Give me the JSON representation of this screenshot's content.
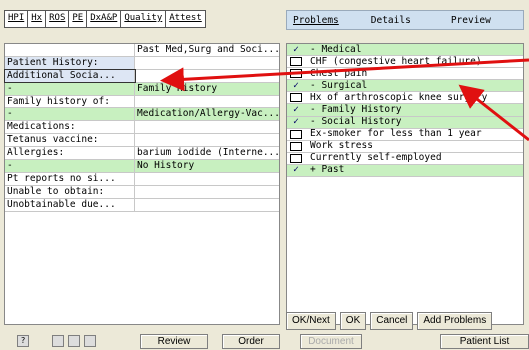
{
  "left_tabs": [
    "HPI",
    "Hx",
    "ROS",
    "PE",
    "DxA&P",
    "Quality",
    "Attest"
  ],
  "left_rows": [
    {
      "label": "",
      "value": "Past Med,Surg and Soci...",
      "kind": "header"
    },
    {
      "label": "Patient History:",
      "value": "",
      "kind": "blue"
    },
    {
      "label": "Additional Socia...",
      "value": "",
      "kind": "sel"
    },
    {
      "label": "-",
      "value": "Family History",
      "kind": "green"
    },
    {
      "label": "Family history of:",
      "value": "",
      "kind": "plain"
    },
    {
      "label": "-",
      "value": "Medication/Allergy-Vac...",
      "kind": "green"
    },
    {
      "label": "Medications:",
      "value": "",
      "kind": "plain"
    },
    {
      "label": "Tetanus vaccine:",
      "value": "",
      "kind": "plain"
    },
    {
      "label": "Allergies:",
      "value": "barium iodide (Interne...",
      "kind": "plain"
    },
    {
      "label": "-",
      "value": "No History",
      "kind": "green"
    },
    {
      "label": "Pt reports no si...",
      "value": "",
      "kind": "plain"
    },
    {
      "label": "Unable to obtain:",
      "value": "",
      "kind": "plain"
    },
    {
      "label": "Unobtainable due...",
      "value": "",
      "kind": "plain"
    }
  ],
  "right_tabs": [
    "Problems",
    "Details",
    "Preview"
  ],
  "right_rows": [
    {
      "mark": "check",
      "text": "- Medical",
      "group": true
    },
    {
      "mark": "box",
      "text": "CHF (congestive heart failure)",
      "group": false
    },
    {
      "mark": "box",
      "text": "Chest pain",
      "group": false
    },
    {
      "mark": "check",
      "text": "- Surgical",
      "group": true
    },
    {
      "mark": "box",
      "text": "Hx of arthroscopic knee surgery",
      "group": false
    },
    {
      "mark": "check",
      "text": "- Family History",
      "group": true
    },
    {
      "mark": "check",
      "text": "- Social History",
      "group": true
    },
    {
      "mark": "box",
      "text": "Ex-smoker for less than 1 year",
      "group": false
    },
    {
      "mark": "box",
      "text": "Work stress",
      "group": false
    },
    {
      "mark": "box",
      "text": "Currently self-employed",
      "group": false
    },
    {
      "mark": "check",
      "text": "+ Past",
      "group": true
    }
  ],
  "right_buttons": {
    "ok_next": "OK/Next",
    "ok": "OK",
    "cancel": "Cancel",
    "add_problems": "Add Problems"
  },
  "bottom": {
    "help": "?",
    "review": "Review",
    "order": "Order",
    "document": "Document",
    "patient_list": "Patient List"
  },
  "colors": {
    "group_green": "#c8f0c0",
    "tab_blue": "#cfe0f0",
    "arrow_red": "#e01010"
  }
}
